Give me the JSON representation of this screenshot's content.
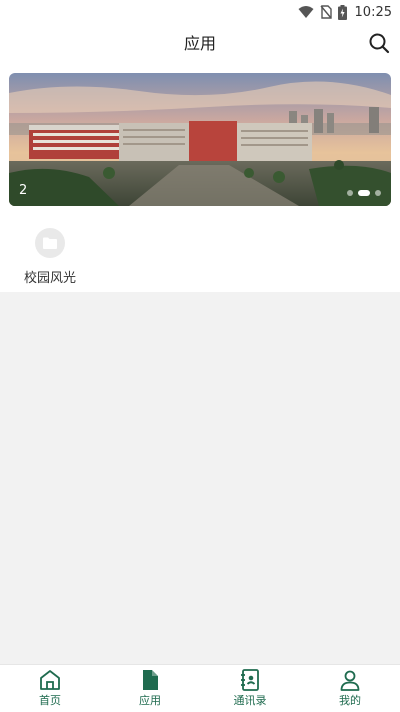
{
  "status_bar": {
    "time": "10:25"
  },
  "header": {
    "title": "应用",
    "search_icon": "search-icon"
  },
  "banner": {
    "index_label": "2",
    "slide_count": 3,
    "active_slide": 2
  },
  "apps": [
    {
      "label": "校园风光",
      "icon": "folder-icon"
    }
  ],
  "tabbar": {
    "items": [
      {
        "label": "首页",
        "icon": "home-icon"
      },
      {
        "label": "应用",
        "icon": "document-icon",
        "active": true
      },
      {
        "label": "通讯录",
        "icon": "contacts-icon"
      },
      {
        "label": "我的",
        "icon": "user-icon"
      }
    ],
    "color": "#1f6b4f"
  }
}
